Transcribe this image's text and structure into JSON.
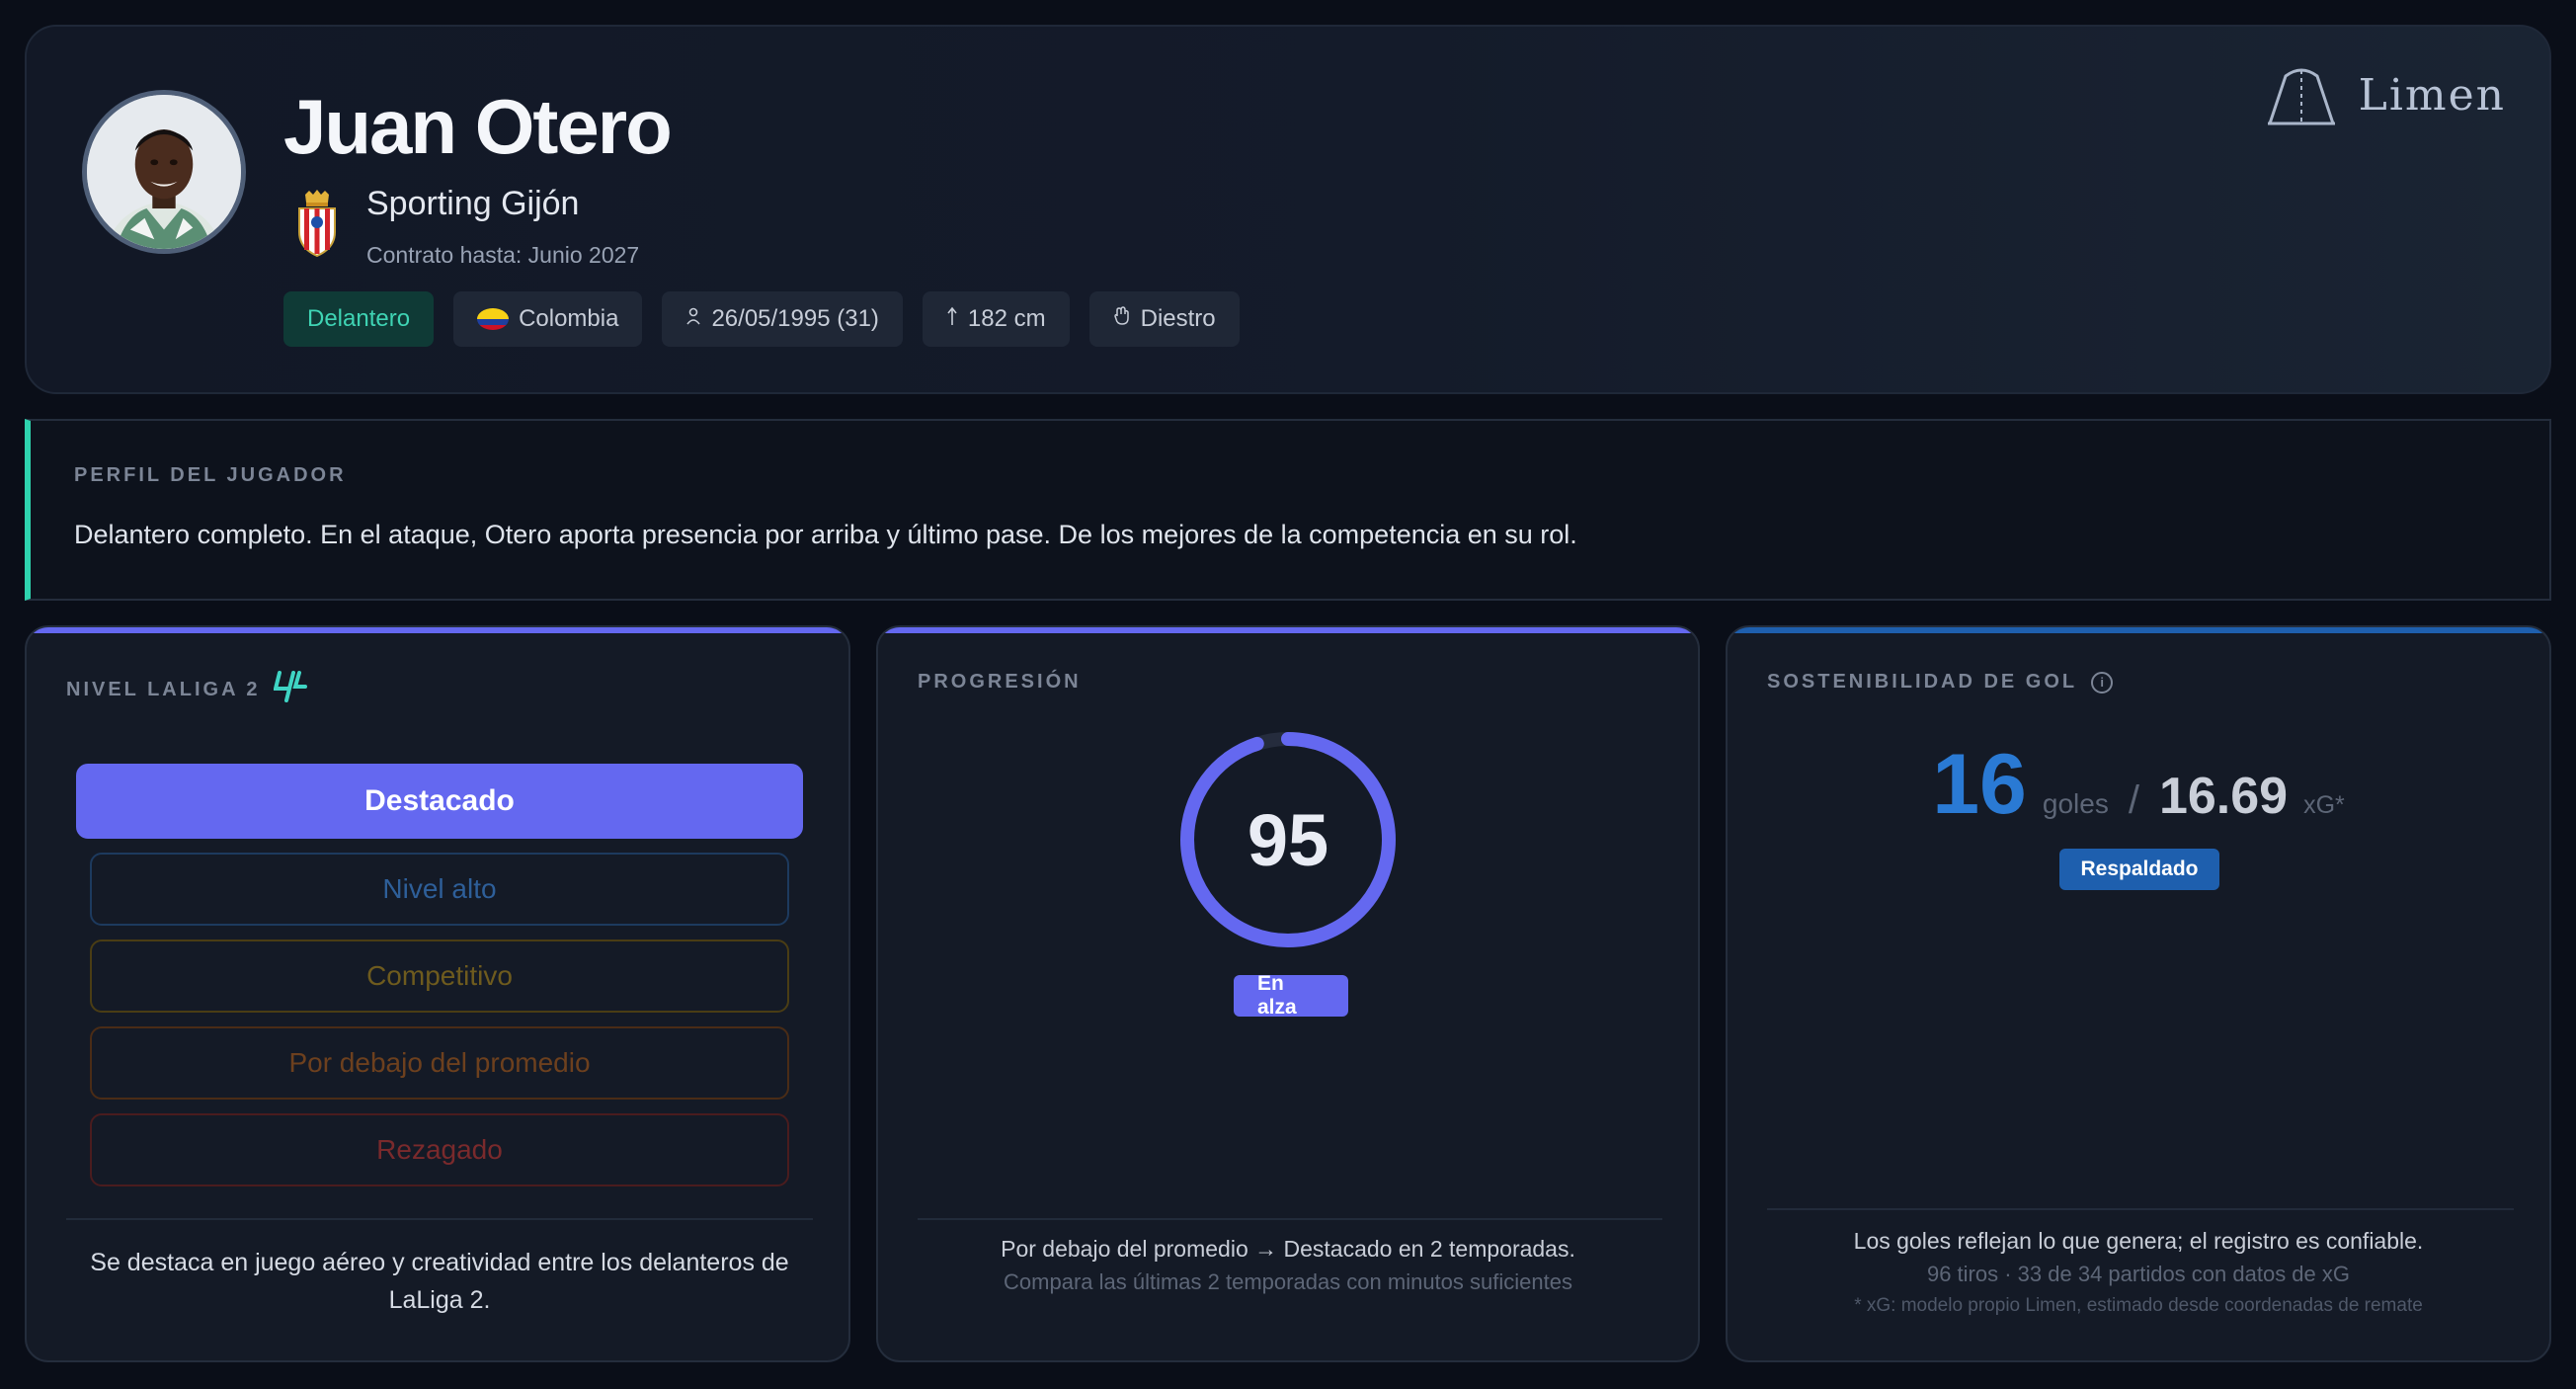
{
  "player": {
    "name": "Juan Otero",
    "club": "Sporting Gijón",
    "contract": "Contrato hasta: Junio 2027"
  },
  "tags": {
    "position": "Delantero",
    "nationality": "Colombia",
    "birth": "26/05/1995 (31)",
    "height": "182 cm",
    "foot": "Diestro"
  },
  "brand": {
    "name": "Limen",
    "icon": "arch-logo"
  },
  "profile": {
    "label": "PERFIL DEL JUGADOR",
    "text": "Delantero completo. En el ataque, Otero aporta presencia por arriba y último pase. De los mejores de la competencia en su rol."
  },
  "level": {
    "title": "NIVEL LALIGA 2",
    "items": [
      "Destacado",
      "Nivel alto",
      "Competitivo",
      "Por debajo del promedio",
      "Rezagado"
    ],
    "active_index": 0,
    "footer": "Se destaca en juego aéreo y creatividad entre los delanteros de LaLiga 2."
  },
  "progression": {
    "title": "PROGRESIÓN",
    "score": "95",
    "score_value": 95,
    "score_max": 100,
    "badge": "En alza",
    "footer_main": "Por debajo del promedio → Destacado en 2 temporadas.",
    "footer_sub": "Compara las últimas 2 temporadas con minutos suficientes"
  },
  "sustainability": {
    "title": "SOSTENIBILIDAD DE GOL",
    "goals": "16",
    "goals_unit": "goles",
    "separator": "/",
    "xg": "16.69",
    "xg_unit": "xG*",
    "badge": "Respaldado",
    "footer_main": "Los goles reflejan lo que genera; el registro es confiable.",
    "footer_sub": "96 tiros · 33 de 34 partidos con datos de xG",
    "footnote": "* xG: modelo propio Limen, estimado desde coordenadas de remate"
  },
  "colors": {
    "accent": "#6468f0",
    "teal": "#2ed3ae",
    "blue": "#2a7ad4",
    "blue_badge": "#1e5fae"
  }
}
